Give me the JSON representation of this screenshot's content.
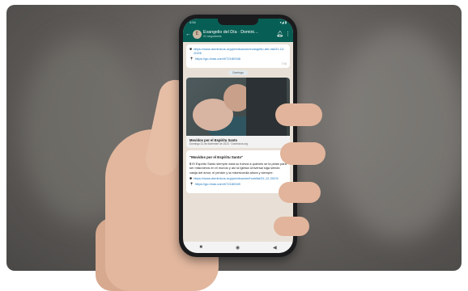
{
  "status_bar": {
    "time": "4:54",
    "indicators": "▾◢ ▮"
  },
  "chat_header": {
    "back_icon": "arrow-left-icon",
    "avatar_letter": "E",
    "title": "Evangelio del Día · Domini…",
    "subtitle": "21 seguidores",
    "bell_icon": "bell-icon",
    "menu_icon": "more-vertical-icon"
  },
  "messages_top": {
    "link_text": "https://www.dominicos.org/predicacion/evangelio-del-dia/31-12-2023/",
    "short_link": "https://go.rivas.com/t/72180348",
    "time": "7:04"
  },
  "date_chip": "Domingo",
  "image_card": {
    "caption_title": "Movidos por el Espíritu Santo",
    "caption_subtitle": "Domingo 31 de diciembre de 2023 · Dominicos.org"
  },
  "post": {
    "title": "\"Movidos por el Espíritu Santo\"",
    "body": "El Espíritu Santo siempre dará su fuerza a quienes se la pidan para ser misioneros en el mundo y así la Iglesia Universal siga siendo vasija del amor, el perdón y la misericordia ahora y siempre.",
    "link_text": "https://www.dominicos.org/predicacion/homilia/31-12-2023/",
    "short_link": "https://go.rivas.com/t/72180349",
    "time": "7:04"
  },
  "nav": {
    "recent": "■",
    "home": "◉",
    "back": "◀"
  },
  "colors": {
    "whatsapp_header": "#075e54",
    "chat_bg": "#e8e0d6",
    "link": "#1a73b8"
  }
}
